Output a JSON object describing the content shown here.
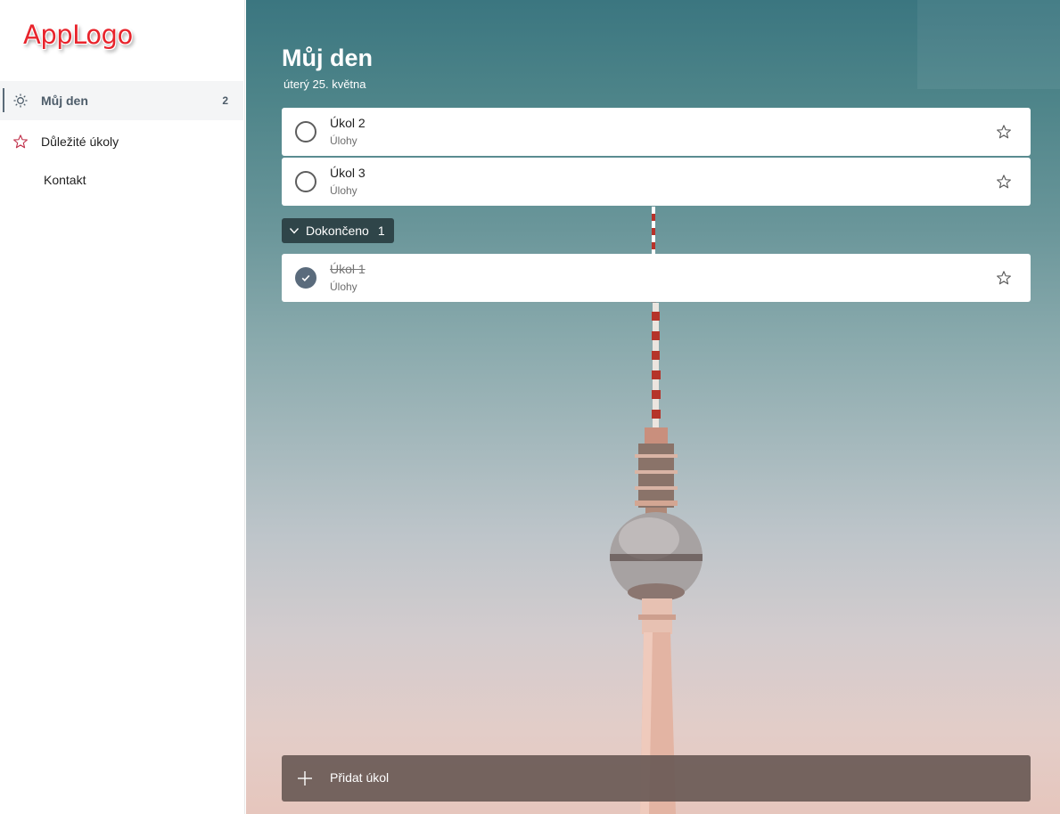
{
  "logo": "AppLogo",
  "sidebar": {
    "items": [
      {
        "label": "Můj den",
        "count": "2",
        "icon": "sun-icon",
        "active": true
      },
      {
        "label": "Důležité úkoly",
        "icon": "star-icon"
      },
      {
        "label": "Kontakt"
      }
    ]
  },
  "main": {
    "title": "Můj den",
    "date": "úterý 25. května",
    "tasks": [
      {
        "title": "Úkol 2",
        "list": "Úlohy",
        "completed": false
      },
      {
        "title": "Úkol 3",
        "list": "Úlohy",
        "completed": false
      }
    ],
    "completed_section": {
      "label": "Dokončeno",
      "count": "1",
      "tasks": [
        {
          "title": "Úkol 1",
          "list": "Úlohy",
          "completed": true
        }
      ]
    },
    "add_task_label": "Přidat úkol"
  },
  "colors": {
    "accent": "#5b6b78",
    "logo": "#e8242c",
    "star_sidebar": "#c0304a",
    "add_bar": "#6a5a56"
  }
}
